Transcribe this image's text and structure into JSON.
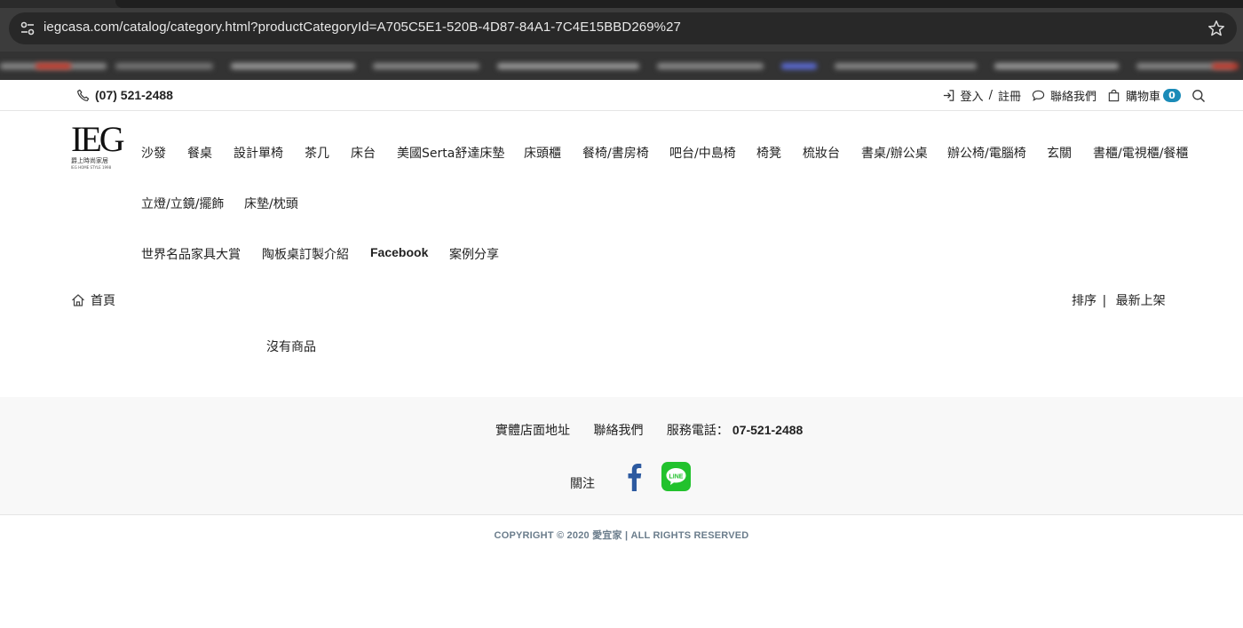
{
  "browser": {
    "url": "iegcasa.com/catalog/category.html?productCategoryId=A705C5E1-520B-4D87-84A1-7C4E15BBD269%27",
    "site_info_icon": "tune-icon",
    "bookmark_icon": "star-icon"
  },
  "topbar": {
    "phone": "(07) 521-2488",
    "login": "登入",
    "slash": "/",
    "register": "註冊",
    "contact": "聯絡我們",
    "cart": "購物車",
    "cart_count": "0",
    "accent_color": "#1b8bb8"
  },
  "logo": {
    "mark": "IEG",
    "subtitle": "爵上時尚家居",
    "subtitle_small": "IEG HOME STYLE 1998"
  },
  "nav": {
    "row1": [
      "沙發",
      "餐桌",
      "設計單椅",
      "茶几",
      "床台",
      "美國Serta舒達床墊",
      "床頭櫃",
      "餐椅/書房椅",
      "吧台/中島椅",
      "椅凳",
      "梳妝台",
      "書桌/辦公桌",
      "辦公椅/電腦椅",
      "玄關",
      "書櫃/電視櫃/餐櫃"
    ],
    "row2": [
      "立燈/立鏡/擺飾",
      "床墊/枕頭"
    ],
    "row3": [
      "世界名品家具大賞",
      "陶板桌訂製介紹",
      "Facebook",
      "案例分享"
    ]
  },
  "breadcrumb": {
    "home": "首頁"
  },
  "sort": {
    "label": "排序",
    "sep": "|",
    "value": "最新上架"
  },
  "main": {
    "empty_message": "沒有商品"
  },
  "footer": {
    "store_address": "實體店面地址",
    "contact": "聯絡我們",
    "service_phone_label": "服務電話：",
    "service_phone": "07-521-2488",
    "follow": "關注",
    "facebook_color": "#2d5aa0",
    "line_color": "#22c22d",
    "line_text": "LINE"
  },
  "copyright": "COPYRIGHT © 2020 愛宜家 | ALL RIGHTS RESERVED"
}
